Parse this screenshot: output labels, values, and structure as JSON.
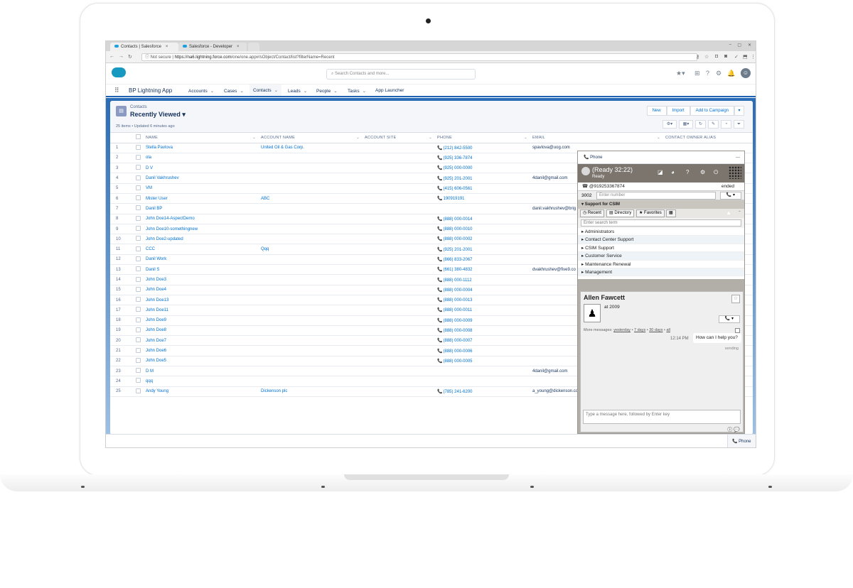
{
  "browser": {
    "tabs": [
      {
        "label": "Contacts | Salesforce"
      },
      {
        "label": "Salesforce - Developer"
      }
    ],
    "security_label": "Not secure",
    "url_host": "https://na6.lightning.force.com",
    "url_path": "/one/one.app#/sObject/Contact/list?filterName=Recent"
  },
  "header": {
    "search_placeholder": "Search Contacts and more..."
  },
  "nav": {
    "app_name": "BP Lightning App",
    "items": [
      {
        "label": "Accounts"
      },
      {
        "label": "Cases"
      },
      {
        "label": "Contacts"
      },
      {
        "label": "Leads"
      },
      {
        "label": "People"
      },
      {
        "label": "Tasks"
      },
      {
        "label": "App Launcher"
      }
    ]
  },
  "list": {
    "object_label": "Contacts",
    "title": "Recently Viewed",
    "meta": "25 items • Updated 6 minutes ago",
    "buttons": {
      "new": "New",
      "import": "Import",
      "add_to_campaign": "Add to Campaign"
    },
    "columns": {
      "name": "NAME",
      "account_name": "ACCOUNT NAME",
      "account_site": "ACCOUNT SITE",
      "phone": "PHONE",
      "email": "EMAIL",
      "owner": "CONTACT OWNER ALIAS"
    },
    "rows": [
      {
        "n": "1",
        "name": "Stella Pavlova",
        "account": "United Oil & Gas Corp.",
        "phone": "(212) 842-5500",
        "email": "spavlova@uog.com"
      },
      {
        "n": "2",
        "name": "ola",
        "account": "",
        "phone": "(925) 336-7874",
        "email": ""
      },
      {
        "n": "3",
        "name": "D V",
        "account": "",
        "phone": "(925) 000-0000",
        "email": ""
      },
      {
        "n": "4",
        "name": "Danil Vakhrushev",
        "account": "",
        "phone": "(925) 201-2001",
        "email": "4danil@gmail.com"
      },
      {
        "n": "5",
        "name": "VM",
        "account": "",
        "phone": "(415) 606-0561",
        "email": ""
      },
      {
        "n": "6",
        "name": "Mister User",
        "account": "ABC",
        "phone": "190919191",
        "email": ""
      },
      {
        "n": "7",
        "name": "Danil BP",
        "account": "",
        "phone": "",
        "email": "danil.vakhrushev@brig"
      },
      {
        "n": "8",
        "name": "John Doe14-AspectDemo",
        "account": "",
        "phone": "(888) 000-0014",
        "email": ""
      },
      {
        "n": "9",
        "name": "John Doe10-somethingnew",
        "account": "",
        "phone": "(888) 000-0010",
        "email": ""
      },
      {
        "n": "10",
        "name": "John Doe2-updated",
        "account": "",
        "phone": "(888) 000-0002",
        "email": ""
      },
      {
        "n": "11",
        "name": "CCC",
        "account": "Qqq",
        "phone": "(925) 201-2001",
        "email": ""
      },
      {
        "n": "12",
        "name": "Danil Work",
        "account": "",
        "phone": "(866) 833-2067",
        "email": ""
      },
      {
        "n": "13",
        "name": "Danil S",
        "account": "",
        "phone": "(661) 380-4832",
        "email": "dvakhrushev@five9.co"
      },
      {
        "n": "14",
        "name": "John Doe3",
        "account": "",
        "phone": "(888) 000-1112",
        "email": ""
      },
      {
        "n": "15",
        "name": "John Doe4",
        "account": "",
        "phone": "(888) 000-0004",
        "email": ""
      },
      {
        "n": "16",
        "name": "John Doe13",
        "account": "",
        "phone": "(888) 000-0013",
        "email": ""
      },
      {
        "n": "17",
        "name": "John Doe11",
        "account": "",
        "phone": "(888) 000-0011",
        "email": ""
      },
      {
        "n": "18",
        "name": "John Doe9",
        "account": "",
        "phone": "(888) 000-0009",
        "email": ""
      },
      {
        "n": "19",
        "name": "John Doe8",
        "account": "",
        "phone": "(888) 000-0008",
        "email": ""
      },
      {
        "n": "20",
        "name": "John Doe7",
        "account": "",
        "phone": "(888) 000-0007",
        "email": ""
      },
      {
        "n": "21",
        "name": "John Doe6",
        "account": "",
        "phone": "(888) 000-0006",
        "email": ""
      },
      {
        "n": "22",
        "name": "John Doe5",
        "account": "",
        "phone": "(888) 000-0005",
        "email": ""
      },
      {
        "n": "23",
        "name": "D M",
        "account": "",
        "phone": "",
        "email": "4danil@gmail.com"
      },
      {
        "n": "24",
        "name": "qqq",
        "account": "",
        "phone": "",
        "email": ""
      },
      {
        "n": "25",
        "name": "Andy Young",
        "account": "Dickenson plc",
        "phone": "(785) 241-6200",
        "email": "a_young@dickenson.co"
      }
    ]
  },
  "softphone": {
    "title": "Phone",
    "status": "(Ready 32:22)",
    "status_sub": "Ready",
    "last_number": "@919253367874",
    "call_state": "ended",
    "station": "3002",
    "number_placeholder": "Enter number",
    "section_title": "Support for CSIM",
    "tabs": {
      "recent": "Recent",
      "directory": "Directory",
      "favorites": "Favorites"
    },
    "search_placeholder": "Enter search term",
    "directory": [
      "Administrators",
      "Contact Center Support",
      "CSIM Support",
      "Customer Service",
      "Maintenance Renewal",
      "Management"
    ],
    "contact": {
      "name": "Allen Fawcett",
      "presence": "at 2009",
      "more_messages_label": "More messages:",
      "links": [
        "yesterday",
        "7 days",
        "30 days",
        "all"
      ],
      "message_time": "12:14 PM",
      "message_text": "How can I help you?",
      "message_status": "sending",
      "compose_placeholder": "Type a message here, followed by Enter key"
    }
  },
  "utility_bar": {
    "phone_label": "Phone"
  },
  "colors": {
    "brand": "#1e63b3",
    "link": "#0070d2",
    "softphone_header": "#7b756e"
  }
}
